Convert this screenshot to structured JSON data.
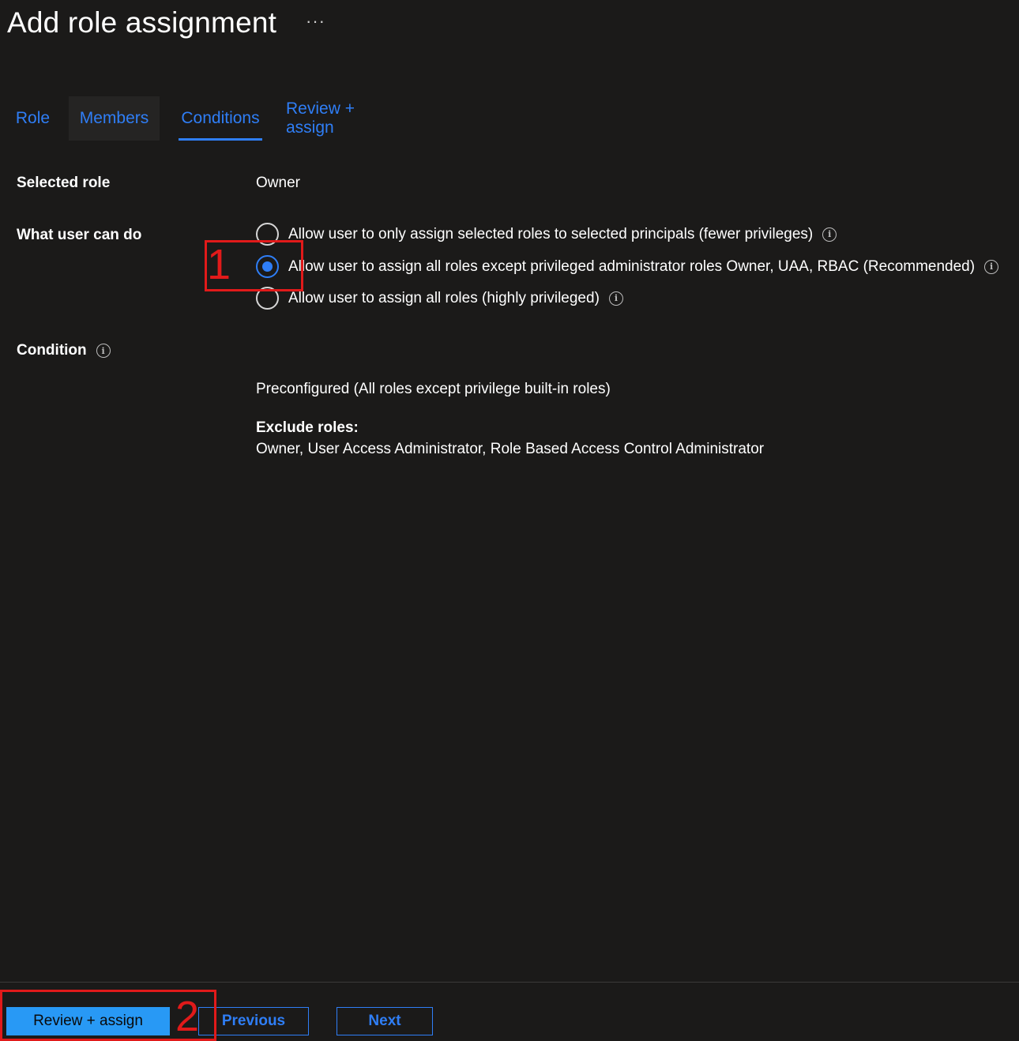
{
  "page": {
    "title": "Add role assignment",
    "more_label": "···"
  },
  "tabs": [
    {
      "label": "Role"
    },
    {
      "label": "Members"
    },
    {
      "label": "Conditions",
      "selected": true
    },
    {
      "label": "Review + assign"
    }
  ],
  "form": {
    "selected_role_label": "Selected role",
    "selected_role_value": "Owner",
    "what_user_can_do_label": "What user can do",
    "options": [
      {
        "label": "Allow user to only assign selected roles to selected principals (fewer privileges)",
        "checked": false
      },
      {
        "label": "Allow user to assign all roles except privileged administrator roles Owner, UAA, RBAC (Recommended)",
        "checked": true
      },
      {
        "label": "Allow user to assign all roles (highly privileged)",
        "checked": false
      }
    ],
    "condition_label": "Condition",
    "condition_value": "Preconfigured (All roles except privilege built-in roles)",
    "exclude_roles_label": "Exclude roles:",
    "exclude_roles_value": "Owner, User Access Administrator, Role Based Access Control Administrator"
  },
  "footer": {
    "review_assign_label": "Review + assign",
    "previous_label": "Previous",
    "next_label": "Next"
  },
  "annotations": [
    {
      "number": "1"
    },
    {
      "number": "2"
    }
  ],
  "icons": {
    "info": "info-icon",
    "radio": "radio-button"
  },
  "colors": {
    "background": "#1b1a19",
    "accent": "#2f7ef6",
    "primary_button": "#2899f5",
    "annotation": "#e11a1a"
  }
}
